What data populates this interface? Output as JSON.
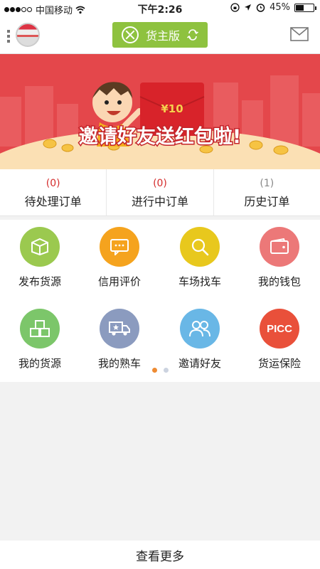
{
  "status_bar": {
    "carrier": "中国移动",
    "time": "下午2:26",
    "battery_text": "45%",
    "battery_level": 0.45
  },
  "header": {
    "role_label": "货主版",
    "menu_icon": "menu-dots-icon",
    "mail_icon": "mail-icon"
  },
  "banner": {
    "title": "邀请好友送红包啦!",
    "red_packet_amount": "¥10"
  },
  "orders": [
    {
      "count": "(0)",
      "label": "待处理订单"
    },
    {
      "count": "(0)",
      "label": "进行中订单"
    },
    {
      "count": "(1)",
      "label": "历史订单"
    }
  ],
  "grid": [
    {
      "label": "发布货源",
      "icon": "box-icon",
      "color": "#9bc94f"
    },
    {
      "label": "信用评价",
      "icon": "chat-icon",
      "color": "#f5a31e"
    },
    {
      "label": "车场找车",
      "icon": "search-icon",
      "color": "#e8c81d"
    },
    {
      "label": "我的钱包",
      "icon": "wallet-icon",
      "color": "#ec7878"
    },
    {
      "label": "我的货源",
      "icon": "boxes-icon",
      "color": "#7cc66a"
    },
    {
      "label": "我的熟车",
      "icon": "truck-icon",
      "color": "#8b9bbf"
    },
    {
      "label": "邀请好友",
      "icon": "friends-icon",
      "color": "#69b7e6"
    },
    {
      "label": "货运保险",
      "icon": "picc-icon",
      "color": "#e9503a",
      "icon_text": "PICC"
    }
  ],
  "footer": {
    "label": "查看更多"
  },
  "colors": {
    "accent": "#8ec23f",
    "banner": "#e4474b",
    "count_red": "#d42b2b"
  }
}
